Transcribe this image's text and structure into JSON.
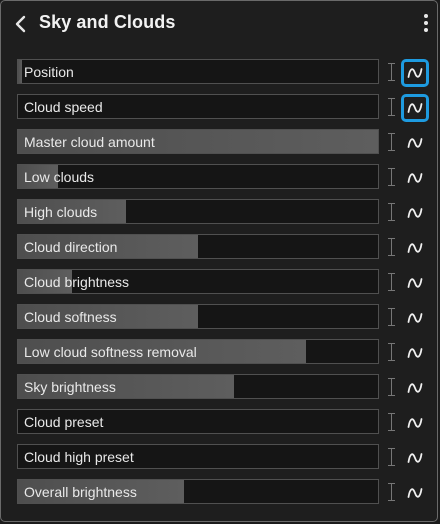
{
  "header": {
    "title": "Sky and Clouds"
  },
  "rows": [
    {
      "label": "Position",
      "value": 0.01,
      "keyframed": true
    },
    {
      "label": "Cloud speed",
      "value": 0.0,
      "keyframed": true
    },
    {
      "label": "Master cloud amount",
      "value": 1.0,
      "keyframed": false
    },
    {
      "label": "Low clouds",
      "value": 0.11,
      "keyframed": false
    },
    {
      "label": "High clouds",
      "value": 0.3,
      "keyframed": false
    },
    {
      "label": "Cloud direction",
      "value": 0.5,
      "keyframed": false
    },
    {
      "label": "Cloud brightness",
      "value": 0.15,
      "keyframed": false
    },
    {
      "label": "Cloud softness",
      "value": 0.5,
      "keyframed": false
    },
    {
      "label": "Low cloud softness removal",
      "value": 0.8,
      "keyframed": false
    },
    {
      "label": "Sky brightness",
      "value": 0.6,
      "keyframed": false
    },
    {
      "label": "Cloud preset",
      "value": 0.0,
      "keyframed": false
    },
    {
      "label": "Cloud high preset",
      "value": 0.0,
      "keyframed": false
    },
    {
      "label": "Overall brightness",
      "value": 0.46,
      "keyframed": false
    }
  ]
}
